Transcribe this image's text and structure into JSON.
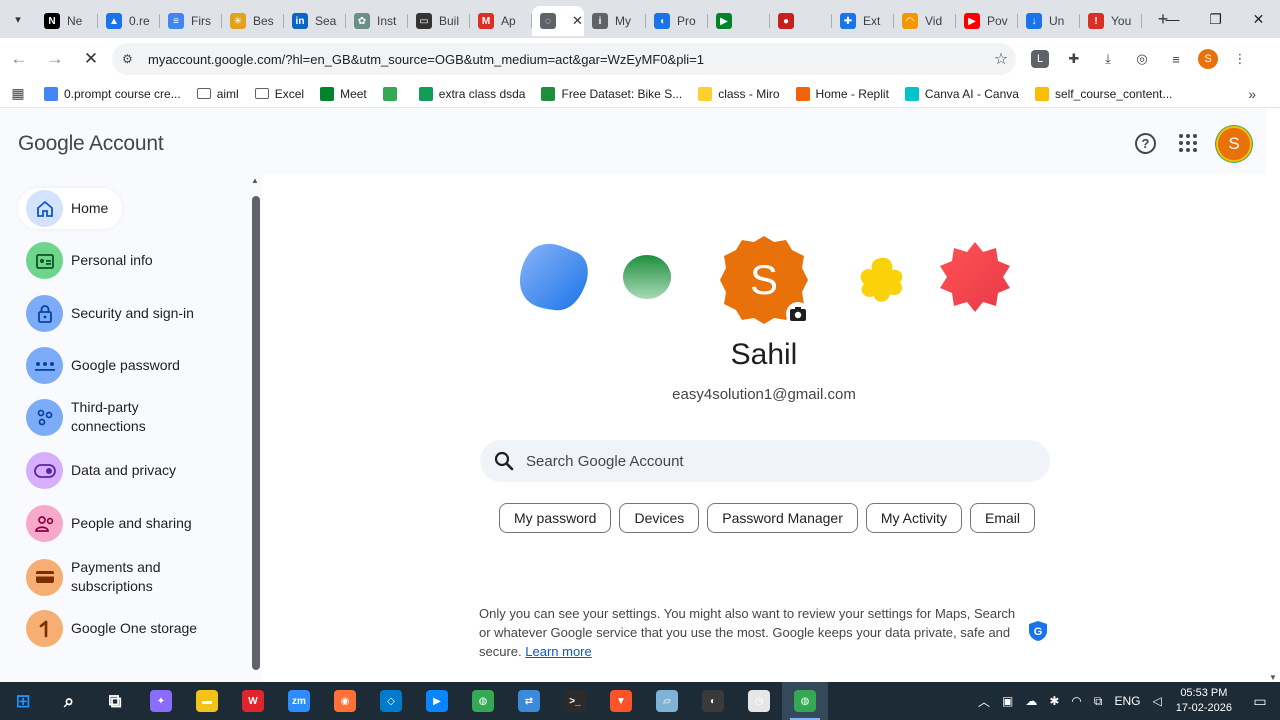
{
  "browser": {
    "tabs": [
      {
        "label": "Ne",
        "icon": "notion-icon",
        "color": "#000000",
        "glyph": "N"
      },
      {
        "label": "0.re",
        "icon": "google-drive-icon",
        "color": "#1a73e8",
        "glyph": "▲"
      },
      {
        "label": "Firs",
        "icon": "google-docs-icon",
        "color": "#4285f4",
        "glyph": "≡"
      },
      {
        "label": "Bes",
        "icon": "perplexity-icon",
        "color": "#e3a21a",
        "glyph": "✳"
      },
      {
        "label": "Sea",
        "icon": "linkedin-icon",
        "color": "#0a66c2",
        "glyph": "in"
      },
      {
        "label": "Inst",
        "icon": "openai-icon",
        "color": "#6b8f86",
        "glyph": "✿"
      },
      {
        "label": "Buil",
        "icon": "builder-icon",
        "color": "#333333",
        "glyph": "▭"
      },
      {
        "label": "Ap",
        "icon": "gmail-icon",
        "color": "#d93025",
        "glyph": "M"
      },
      {
        "label": "",
        "icon": "loading-icon",
        "color": "#5f6368",
        "glyph": "◌",
        "active": true
      },
      {
        "label": "My",
        "icon": "info-icon",
        "color": "#5f6368",
        "glyph": "i"
      },
      {
        "label": "Pro",
        "icon": "cursor-icon",
        "color": "#1a73e8",
        "glyph": "◖"
      },
      {
        "label": "",
        "icon": "meet-icon",
        "color": "#00832d",
        "glyph": "▶"
      },
      {
        "label": "",
        "icon": "record-icon",
        "color": "#c5221f",
        "glyph": "●"
      },
      {
        "label": "Ext",
        "icon": "puzzle-icon",
        "color": "#1a73e8",
        "glyph": "✚"
      },
      {
        "label": "Vid",
        "icon": "rainbow-icon",
        "color": "#f29900",
        "glyph": "◠"
      },
      {
        "label": "Pov",
        "icon": "youtube-icon",
        "color": "#ff0000",
        "glyph": "▶"
      },
      {
        "label": "Un",
        "icon": "download-icon",
        "color": "#1a73e8",
        "glyph": "↓"
      },
      {
        "label": "You",
        "icon": "error-icon",
        "color": "#d93025",
        "glyph": "!"
      }
    ],
    "url": "myaccount.google.com/?hl=en_GB&utm_source=OGB&utm_medium=act&gar=WzEyMF0&pli=1",
    "extension_letter": "L",
    "profile_letter": "S",
    "bookmarks": [
      {
        "label": "0.prompt course cre...",
        "icon": "docs-icon",
        "color": "#4285f4"
      },
      {
        "label": "aiml",
        "icon": "folder-icon",
        "color": "#5f6368"
      },
      {
        "label": "Excel",
        "icon": "folder-icon",
        "color": "#5f6368"
      },
      {
        "label": "Meet",
        "icon": "meet-icon",
        "color": "#00832d"
      },
      {
        "label": "",
        "icon": "tree-icon",
        "color": "#34a853"
      },
      {
        "label": "extra class dsda",
        "icon": "classroom-icon",
        "color": "#0f9d58"
      },
      {
        "label": "Free Dataset: Bike S...",
        "icon": "dataset-icon",
        "color": "#1e8e3e"
      },
      {
        "label": "class - Miro",
        "icon": "miro-icon",
        "color": "#ffd02f"
      },
      {
        "label": "Home - Replit",
        "icon": "replit-icon",
        "color": "#f26207"
      },
      {
        "label": "Canva AI - Canva",
        "icon": "canva-icon",
        "color": "#00c4cc"
      },
      {
        "label": "self_course_content...",
        "icon": "drive-icon",
        "color": "#fbbc04"
      }
    ]
  },
  "header": {
    "logo": "Google Account",
    "avatar_letter": "S"
  },
  "sidebar": {
    "items": [
      {
        "label": "Home",
        "icon": "home-icon",
        "bg": "#d3e3fd",
        "fg": "#0b57d0"
      },
      {
        "label": "Personal info",
        "icon": "id-card-icon",
        "bg": "#6dd58c",
        "fg": "#0f5223"
      },
      {
        "label": "Security and sign-in",
        "icon": "lock-icon",
        "bg": "#7cacf8",
        "fg": "#0842a0"
      },
      {
        "label": "Google password",
        "icon": "password-dots-icon",
        "bg": "#7cacf8",
        "fg": "#0842a0"
      },
      {
        "label": "Third-party connections",
        "icon": "connections-icon",
        "bg": "#7cacf8",
        "fg": "#0842a0"
      },
      {
        "label": "Data and privacy",
        "icon": "toggle-icon",
        "bg": "#d7aefb",
        "fg": "#5629a4"
      },
      {
        "label": "People and sharing",
        "icon": "people-icon",
        "bg": "#f8a8c9",
        "fg": "#8a0046"
      },
      {
        "label": "Payments and subscriptions",
        "icon": "wallet-icon",
        "bg": "#f6ae73",
        "fg": "#7a2e00"
      },
      {
        "label": "Google One storage",
        "icon": "google-one-icon",
        "bg": "#f6ae73",
        "fg": "#7a2e00"
      }
    ]
  },
  "main": {
    "avatar_letter": "S",
    "name": "Sahil",
    "email": "easy4solution1@gmail.com",
    "search_placeholder": "Search Google Account",
    "chips": [
      "My password",
      "Devices",
      "Password Manager",
      "My Activity",
      "Email"
    ],
    "privacy_text": "Only you can see your settings. You might also want to review your settings for Maps, Search or whatever Google service that you use the most. Google keeps your data private, safe and secure.",
    "learn_more": "Learn more"
  },
  "taskbar": {
    "apps": [
      {
        "icon": "windows-start-icon",
        "color": "#1e90ff"
      },
      {
        "icon": "search-icon",
        "color": "#ffffff"
      },
      {
        "icon": "task-view-icon",
        "color": "#ffffff"
      },
      {
        "icon": "copilot-icon",
        "color": "#8a6cff"
      },
      {
        "icon": "file-explorer-icon",
        "color": "#f0c419"
      },
      {
        "icon": "wps-office-icon",
        "color": "#e0262c"
      },
      {
        "icon": "zoom-icon",
        "color": "#2d8cff"
      },
      {
        "icon": "firefox-icon",
        "color": "#ff7139"
      },
      {
        "icon": "vscode-icon",
        "color": "#007acc"
      },
      {
        "icon": "screen-recorder-icon",
        "color": "#0a84ff"
      },
      {
        "icon": "chrome-icon",
        "color": "#34a853"
      },
      {
        "icon": "remote-desktop-icon",
        "color": "#3b8ad9"
      },
      {
        "icon": "terminal-icon",
        "color": "#2b2b2b"
      },
      {
        "icon": "brave-icon",
        "color": "#fb542b"
      },
      {
        "icon": "notepad-icon",
        "color": "#7fb3d5"
      },
      {
        "icon": "obs-icon",
        "color": "#3a3a3a"
      },
      {
        "icon": "clock-app-icon",
        "color": "#e6e6e6"
      },
      {
        "icon": "chrome-active-icon",
        "color": "#34a853"
      }
    ],
    "lang": "ENG",
    "time": "05:53 PM",
    "date": "17-02-2026"
  }
}
